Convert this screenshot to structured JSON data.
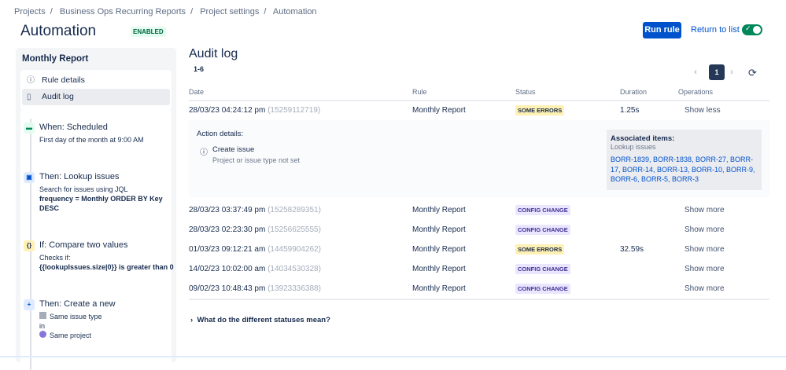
{
  "breadcrumb": [
    "Projects",
    "Business Ops Recurring Reports",
    "Project settings",
    "Automation"
  ],
  "page_title": "Automation",
  "status_badge": "ENABLED",
  "run_rule": "Run rule",
  "return_to_list": "Return to list",
  "toggle_on": true,
  "sidebar": {
    "rule_name": "Monthly Report",
    "menu": [
      {
        "label": "Rule details",
        "icon": "info-icon"
      },
      {
        "label": "Audit log",
        "icon": "document-icon"
      }
    ],
    "steps": [
      {
        "title": "When: Scheduled",
        "desc": "First day of the month at 9:00 AM",
        "icon": "calendar-icon"
      },
      {
        "title": "Then: Lookup issues",
        "desc": "Search for issues using JQL",
        "bold": "frequency = Monthly ORDER BY Key DESC",
        "icon": "lookup-icon"
      },
      {
        "title": "If: Compare two values",
        "desc": "Checks if:",
        "bold": "{{lookupIssues.size|0}} is greater than 0",
        "icon": "braces-icon"
      },
      {
        "title": "Then: Create a new",
        "line1": "Same issue type",
        "line2": "in",
        "line3": "Same project",
        "icon": "plus-icon"
      }
    ]
  },
  "audit": {
    "title": "Audit log",
    "range": "1-6",
    "page": "1",
    "columns": [
      "Date",
      "Rule",
      "Status",
      "Duration",
      "Operations"
    ],
    "rows": [
      {
        "date": "28/03/23 04:24:12 pm",
        "id": "(15259112719)",
        "rule": "Monthly Report",
        "status": "SOME ERRORS",
        "duration": "1.25s",
        "op": "Show less"
      },
      {
        "date": "28/03/23 03:37:49 pm",
        "id": "(15258289351)",
        "rule": "Monthly Report",
        "status": "CONFIG CHANGE",
        "duration": "",
        "op": "Show more"
      },
      {
        "date": "28/03/23 02:23:30 pm",
        "id": "(15256625555)",
        "rule": "Monthly Report",
        "status": "CONFIG CHANGE",
        "duration": "",
        "op": "Show more"
      },
      {
        "date": "01/03/23 09:12:21 am",
        "id": "(14459904262)",
        "rule": "Monthly Report",
        "status": "SOME ERRORS",
        "duration": "32.59s",
        "op": "Show more"
      },
      {
        "date": "14/02/23 10:02:00 am",
        "id": "(14034530328)",
        "rule": "Monthly Report",
        "status": "CONFIG CHANGE",
        "duration": "",
        "op": "Show more"
      },
      {
        "date": "09/02/23 10:48:43 pm",
        "id": "(13923336388)",
        "rule": "Monthly Report",
        "status": "CONFIG CHANGE",
        "duration": "",
        "op": "Show more"
      }
    ],
    "detail": {
      "heading": "Action details:",
      "action": "Create issue",
      "action_sub": "Project or issue type not set",
      "assoc_title": "Associated items:",
      "assoc_label": "Lookup issues",
      "assoc_items": "BORR-1839, BORR-1838, BORR-27, BORR-17, BORR-14, BORR-13, BORR-10, BORR-9, BORR-6, BORR-5, BORR-3"
    },
    "faq": "What do the different statuses mean?"
  }
}
